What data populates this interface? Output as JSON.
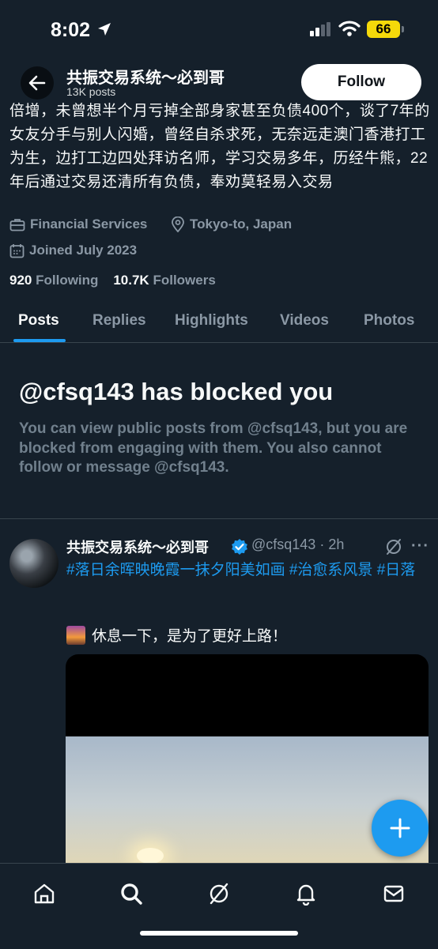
{
  "status_bar": {
    "time": "8:02",
    "battery": "66"
  },
  "header": {
    "name": "共振交易系统～必到哥",
    "posts": "13K posts",
    "follow_label": "Follow"
  },
  "bio": "倍增，未曾想半个月亏掉全部身家甚至负债400个，谈了7年的女友分手与别人闪婚，曾经自杀求死，无奈远走澳门香港打工为生，边打工边四处拜访名师，学习交易多年，历经牛熊，22年后通过交易还清所有负债，奉劝莫轻易入交易",
  "profile_meta": {
    "category": "Financial Services",
    "location": "Tokyo-to, Japan",
    "joined": "Joined July 2023"
  },
  "stats": {
    "following_count": "920",
    "following_label": "Following",
    "followers_count": "10.7K",
    "followers_label": "Followers"
  },
  "tabs": [
    {
      "label": "Posts",
      "active": true
    },
    {
      "label": "Replies"
    },
    {
      "label": "Highlights"
    },
    {
      "label": "Videos"
    },
    {
      "label": "Photos"
    }
  ],
  "blocked": {
    "title": "@cfsq143 has blocked you",
    "message": "You can view public posts from @cfsq143, but you are blocked from engaging with them. You also cannot follow or message @cfsq143."
  },
  "post": {
    "author": "共振交易系统～必到哥",
    "handle_time": "@cfsq143 · 2h",
    "hashtags": "#落日余晖映晚霞一抹夕阳美如画 #治愈系风景 #日落",
    "text": "休息一下，是为了更好上路！"
  },
  "colors": {
    "background": "#15202b",
    "accent": "#1d9bf0",
    "muted": "#8b98a5"
  },
  "icons": [
    "location-arrow-icon",
    "signal-icon",
    "wifi-icon",
    "back-arrow-icon",
    "briefcase-icon",
    "location-pin-icon",
    "calendar-icon",
    "verified-badge-icon",
    "grok-icon",
    "more-icon",
    "plus-icon",
    "home-icon",
    "search-icon",
    "bell-icon",
    "mail-icon"
  ]
}
